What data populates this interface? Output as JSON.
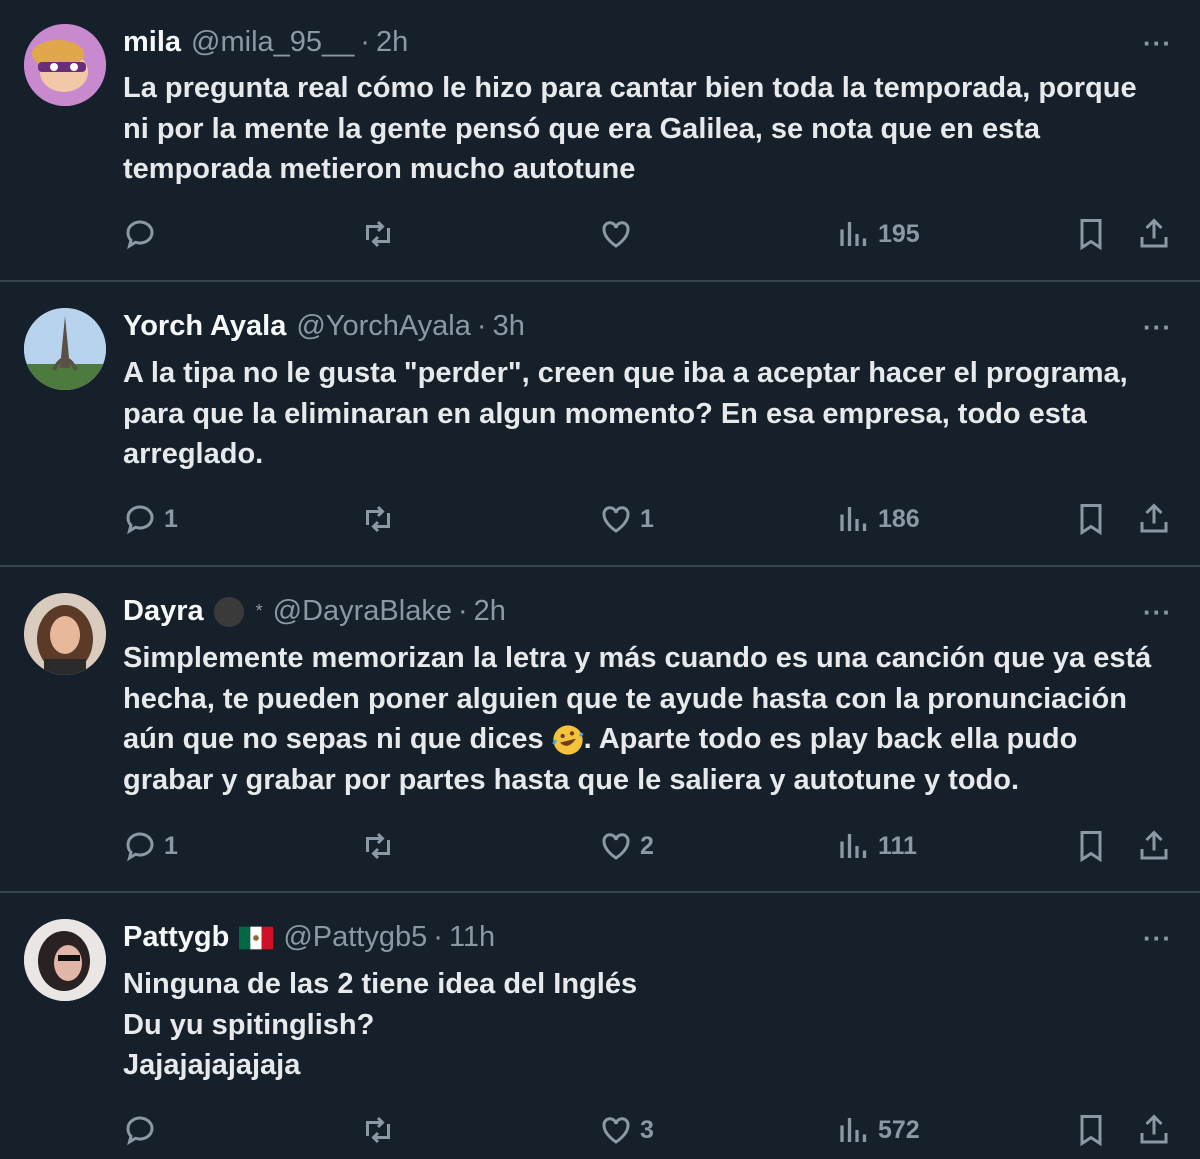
{
  "tweets": [
    {
      "name": "mila",
      "handle": "@mila_95__",
      "dot": "·",
      "time": "2h",
      "more": "···",
      "lines": [
        "La pregunta real cómo le hizo para cantar bien toda la temporada,  porque",
        "ni por la mente la gente pensó que era Galilea,  se nota que en esta",
        "temporada metieron mucho autotune"
      ],
      "replies": "",
      "likes": "",
      "views": "195"
    },
    {
      "name": "Yorch Ayala",
      "handle": "@YorchAyala",
      "dot": "·",
      "time": "3h",
      "more": "···",
      "lines": [
        "A la tipa no le gusta \"perder\", creen que iba a aceptar hacer el programa,",
        "para que la eliminaran en algun momento? En esa empresa, todo esta",
        "arreglado."
      ],
      "replies": "1",
      "likes": "1",
      "views": "186"
    },
    {
      "name": "Dayra",
      "handle": "@DayraBlake",
      "dot": "·",
      "time": "2h",
      "more": "···",
      "lines": [
        "Simplemente memorizan la letra y más cuando es una canción que ya está",
        "hecha, te pueden poner alguien que te ayude hasta con la pronunciación",
        "aún que no sepas ni que dices",
        "grabar y grabar por partes hasta que le saliera y autotune y todo."
      ],
      "line3_after_emoji": ". Aparte todo es play back ella pudo",
      "name_badge": "*",
      "replies": "1",
      "likes": "2",
      "views": "111"
    },
    {
      "name": "Pattygb",
      "handle": "@Pattygb5",
      "dot": "·",
      "time": "11h",
      "more": "···",
      "lines": [
        "Ninguna de las 2 tiene idea del Inglés",
        "Du yu spitinglish?",
        "Jajajajajajaja"
      ],
      "replies": "",
      "likes": "3",
      "views": "572"
    }
  ],
  "colors": {
    "background": "#15202b",
    "divider": "#38444d",
    "muted": "#8b98a5",
    "text": "#e7e9ea"
  },
  "icons": [
    "reply-icon",
    "retweet-icon",
    "like-icon",
    "views-icon",
    "bookmark-icon",
    "share-icon",
    "more-icon"
  ]
}
